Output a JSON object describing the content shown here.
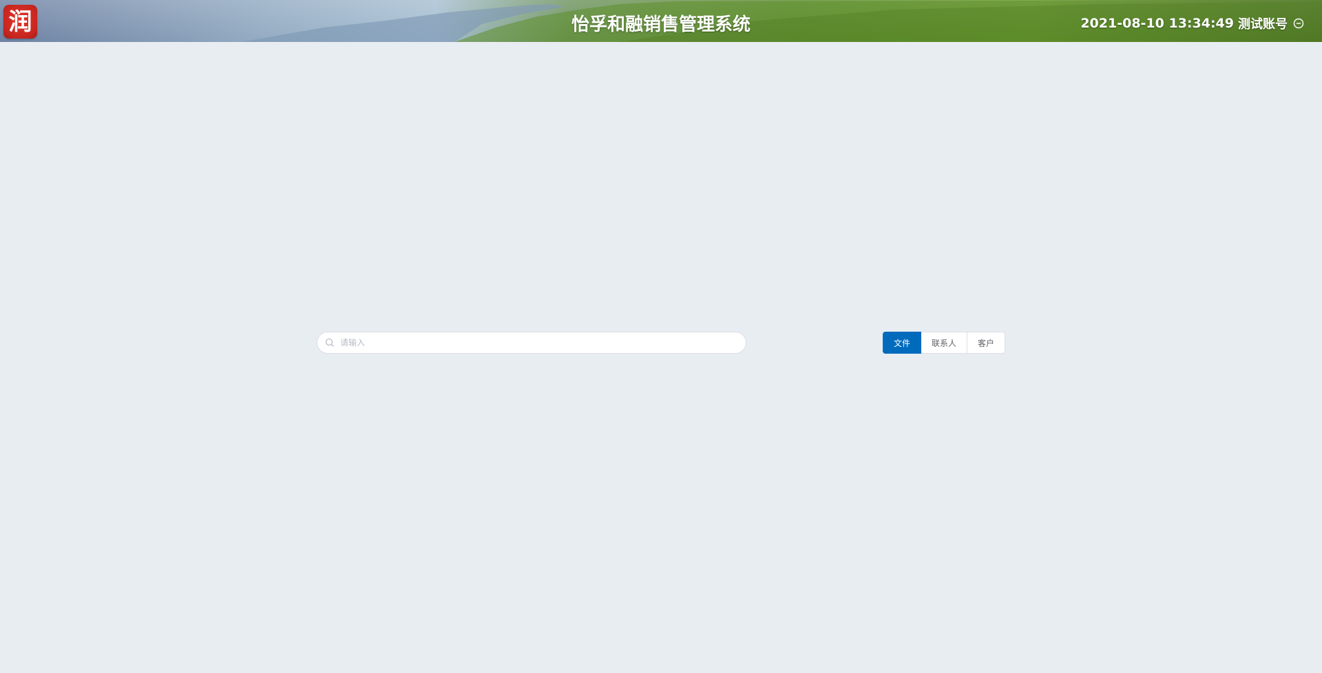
{
  "header": {
    "logo_char": "润",
    "title": "怡孚和融销售管理系统",
    "datetime": "2021-08-10 13:34:49",
    "username": "测试账号",
    "logout_icon": "minus-circle-icon"
  },
  "search": {
    "placeholder": "请输入",
    "value": "",
    "icon": "search-icon"
  },
  "filter_tabs": {
    "items": [
      "文件",
      "联系人",
      "客户"
    ],
    "active": "文件"
  },
  "colors": {
    "background": "#e8edf2",
    "accent": "#006bbd"
  }
}
